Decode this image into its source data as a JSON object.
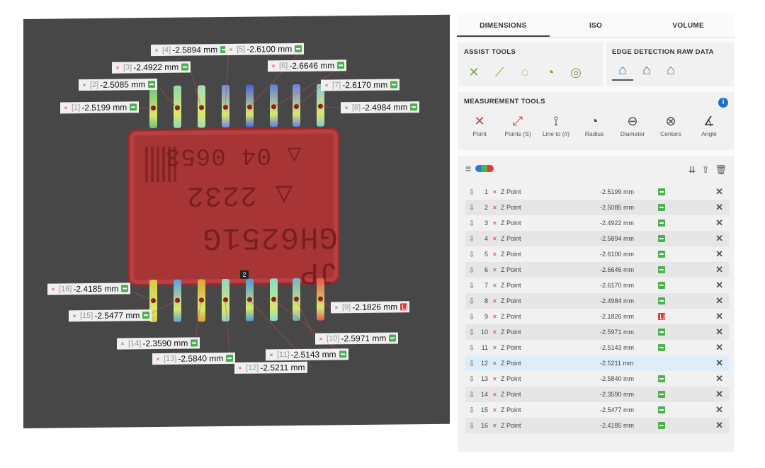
{
  "viewport": {
    "chip_markings": [
      "△ 04 0653",
      "△ 2232",
      "JP GH6251G"
    ],
    "center_marker": "2",
    "labels": [
      {
        "idx": "[4]",
        "value": "-2.5894 mm",
        "status": "ok"
      },
      {
        "idx": "[5]",
        "value": "-2.6100 mm",
        "status": "ok"
      },
      {
        "idx": "[3]",
        "value": "-2.4922 mm",
        "status": "ok"
      },
      {
        "idx": "[6]",
        "value": "-2.6646 mm",
        "status": "ok"
      },
      {
        "idx": "[2]",
        "value": "-2.5085 mm",
        "status": "ok"
      },
      {
        "idx": "[7]",
        "value": "-2.6170 mm",
        "status": "ok"
      },
      {
        "idx": "[1]",
        "value": "-2.5199 mm",
        "status": "ok"
      },
      {
        "idx": "[8]",
        "value": "-2.4984 mm",
        "status": "ok"
      },
      {
        "idx": "[16]",
        "value": "-2.4185 mm",
        "status": "ok"
      },
      {
        "idx": "[9]",
        "value": "-2.1826 mm",
        "status": "bad"
      },
      {
        "idx": "[15]",
        "value": "-2.5477 mm",
        "status": "ok"
      },
      {
        "idx": "[14]",
        "value": "-2.3590 mm",
        "status": "ok"
      },
      {
        "idx": "[10]",
        "value": "-2.5971 mm",
        "status": "ok"
      },
      {
        "idx": "[11]",
        "value": "-2.5143 mm",
        "status": "ok"
      },
      {
        "idx": "[13]",
        "value": "-2.5840 mm",
        "status": "ok"
      },
      {
        "idx": "[12]",
        "value": "-2.5211 mm",
        "status": "none"
      }
    ]
  },
  "tabs": [
    "DIMENSIONS",
    "ISO",
    "VOLUME"
  ],
  "assist_tools": {
    "title": "ASSIST TOOLS",
    "icons": [
      "cross-icon",
      "line-icon",
      "circle-dashed-icon",
      "circle-radius-icon",
      "circle-concentric-icon"
    ]
  },
  "edge_detection": {
    "title": "EDGE DETECTION RAW DATA",
    "icons": [
      "house-blue-icon",
      "house-gray-icon",
      "house-brown-icon"
    ]
  },
  "measurement_tools": {
    "title": "MEASUREMENT TOOLS",
    "tools": [
      {
        "label": "Point",
        "icon": "point-icon"
      },
      {
        "label": "Points (S)",
        "icon": "points-icon"
      },
      {
        "label": "Line to (//)",
        "icon": "line-to-icon"
      },
      {
        "label": "Radius",
        "icon": "radius-icon"
      },
      {
        "label": "Diameter",
        "icon": "diameter-icon"
      },
      {
        "label": "Centers",
        "icon": "centers-icon"
      },
      {
        "label": "Angle",
        "icon": "angle-icon"
      }
    ]
  },
  "list": {
    "rows": [
      {
        "num": "1",
        "name": "Z Point",
        "value": "-2.5199 mm",
        "status": "ok"
      },
      {
        "num": "2",
        "name": "Z Point",
        "value": "-2.5085 mm",
        "status": "ok"
      },
      {
        "num": "3",
        "name": "Z Point",
        "value": "-2.4922 mm",
        "status": "ok"
      },
      {
        "num": "4",
        "name": "Z Point",
        "value": "-2.5894 mm",
        "status": "ok"
      },
      {
        "num": "5",
        "name": "Z Point",
        "value": "-2.6100 mm",
        "status": "ok"
      },
      {
        "num": "6",
        "name": "Z Point",
        "value": "-2.6646 mm",
        "status": "ok"
      },
      {
        "num": "7",
        "name": "Z Point",
        "value": "-2.6170 mm",
        "status": "ok"
      },
      {
        "num": "8",
        "name": "Z Point",
        "value": "-2.4984 mm",
        "status": "ok"
      },
      {
        "num": "9",
        "name": "Z Point",
        "value": "-2.1826 mm",
        "status": "bad"
      },
      {
        "num": "10",
        "name": "Z Point",
        "value": "-2.5971 mm",
        "status": "ok"
      },
      {
        "num": "11",
        "name": "Z Point",
        "value": "-2.5143 mm",
        "status": "ok"
      },
      {
        "num": "12",
        "name": "Z Point",
        "value": "-2.5211 mm",
        "status": "none"
      },
      {
        "num": "13",
        "name": "Z Point",
        "value": "-2.5840 mm",
        "status": "ok"
      },
      {
        "num": "14",
        "name": "Z Point",
        "value": "-2.3590 mm",
        "status": "ok"
      },
      {
        "num": "15",
        "name": "Z Point",
        "value": "-2.5477 mm",
        "status": "ok"
      },
      {
        "num": "16",
        "name": "Z Point",
        "value": "-2.4185 mm",
        "status": "ok"
      }
    ]
  },
  "colors": {
    "ok": "#4caf50",
    "bad": "#e53935",
    "accent": "#1e6fd0",
    "chip": "#a83535",
    "viewport_bg": "#474747"
  }
}
